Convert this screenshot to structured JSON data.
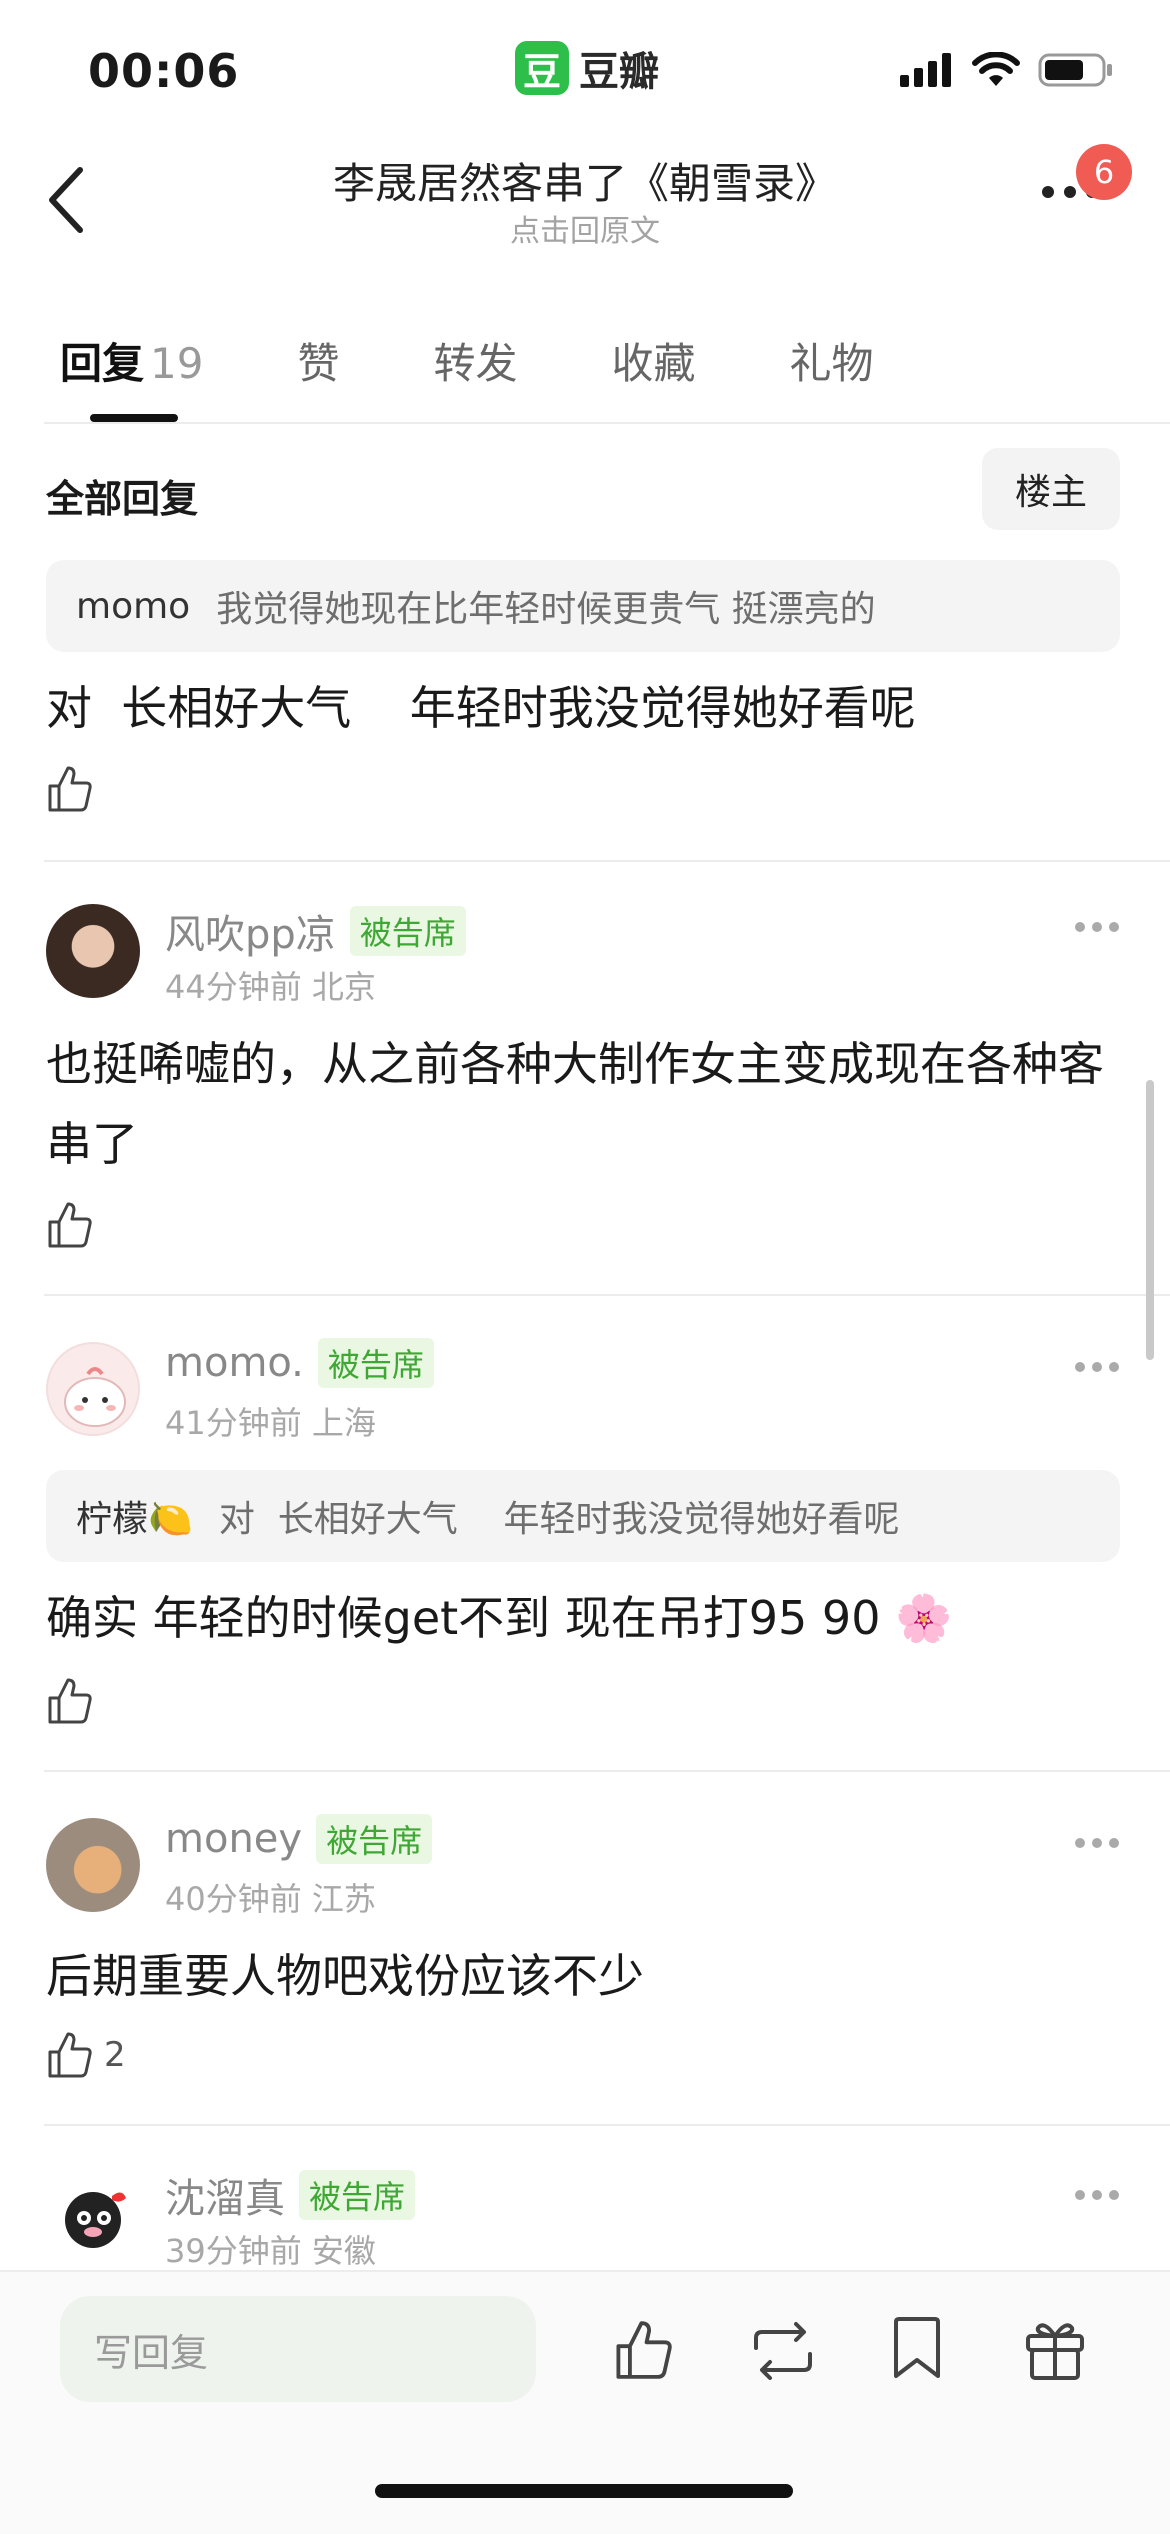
{
  "status_bar": {
    "time": "00:06",
    "app_logo_char": "豆",
    "app_name": "豆瓣"
  },
  "nav": {
    "title": "李晟居然客串了《朝雪录》",
    "subtitle": "点击回原文",
    "badge_count": "6"
  },
  "tabs": [
    {
      "label": "回复",
      "count": "19"
    },
    {
      "label": "赞"
    },
    {
      "label": "转发"
    },
    {
      "label": "收藏"
    },
    {
      "label": "礼物"
    }
  ],
  "section": {
    "label": "全部回复",
    "filter_button": "楼主"
  },
  "top_reply": {
    "quote_name": "momo",
    "quote_text": "我觉得她现在比年轻时候更贵气 挺漂亮的",
    "text": "对  长相好大气    年轻时我没觉得她好看呢"
  },
  "comments": [
    {
      "username": "风吹pp凉",
      "tag": "被告席",
      "time": "44分钟前",
      "location": "北京",
      "text": "也挺唏嘘的，从之前各种大制作女主变成现在各种客串了",
      "likes": ""
    },
    {
      "username": "momo.",
      "tag": "被告席",
      "time": "41分钟前",
      "location": "上海",
      "quote_name": "柠檬🍋",
      "quote_text": "对  长相好大气    年轻时我没觉得她好看呢",
      "text": "确实 年轻的时候get不到 现在吊打95 90 🌸",
      "likes": ""
    },
    {
      "username": "money",
      "tag": "被告席",
      "time": "40分钟前",
      "location": "江苏",
      "text": "后期重要人物吧戏份应该不少",
      "likes": "2"
    },
    {
      "username": "沈溜真",
      "tag": "被告席",
      "time": "39分钟前",
      "location": "安徽"
    }
  ],
  "bottom_bar": {
    "reply_placeholder": "写回复"
  },
  "colors": {
    "accent_green": "#2dbf4a",
    "tag_green": "#3fa834",
    "badge_red": "#f05b54"
  }
}
